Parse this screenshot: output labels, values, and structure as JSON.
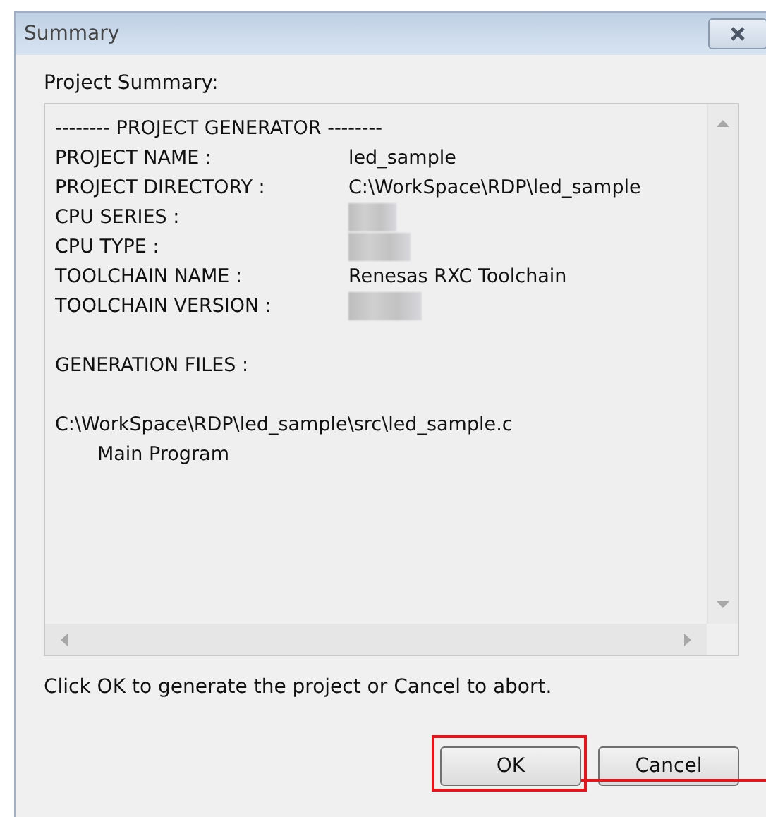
{
  "window": {
    "title": "Summary"
  },
  "summary_label": "Project Summary:",
  "summary": [
    {
      "kind": "heading",
      "text": "-------- PROJECT GENERATOR --------"
    },
    {
      "kind": "field",
      "label": "PROJECT NAME :",
      "value": "led_sample"
    },
    {
      "kind": "field",
      "label": "PROJECT DIRECTORY :",
      "value": "C:\\WorkSpace\\RDP\\led_sample"
    },
    {
      "kind": "redacted",
      "label": "CPU SERIES :"
    },
    {
      "kind": "redacted",
      "label": "CPU TYPE :"
    },
    {
      "kind": "field",
      "label": "TOOLCHAIN NAME :",
      "value": "Renesas RXC Toolchain"
    },
    {
      "kind": "redacted",
      "label": "TOOLCHAIN VERSION :"
    },
    {
      "kind": "blank"
    },
    {
      "kind": "heading",
      "text": "GENERATION FILES :"
    },
    {
      "kind": "blank"
    },
    {
      "kind": "heading",
      "text": "C:\\WorkSpace\\RDP\\led_sample\\src\\led_sample.c"
    },
    {
      "kind": "indent",
      "text": "Main Program"
    }
  ],
  "hint": "Click OK to generate the project or Cancel to abort.",
  "buttons": [
    {
      "label": "OK",
      "highlighted": true
    },
    {
      "label": "Cancel",
      "highlighted": false
    }
  ]
}
